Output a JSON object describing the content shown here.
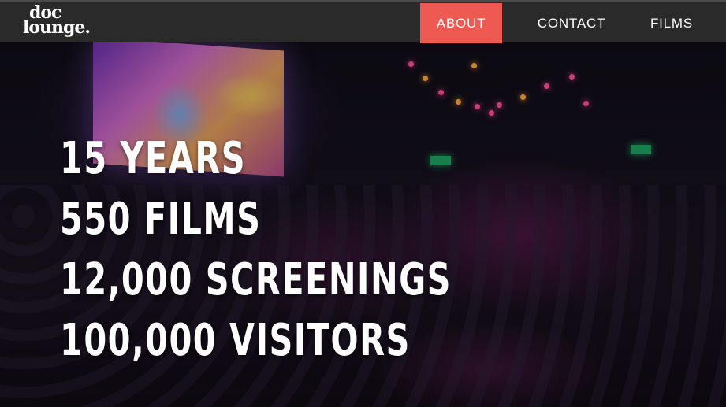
{
  "nav": {
    "logo": {
      "line1": "doc",
      "line2": "lounge."
    },
    "items": [
      {
        "label": "ABOUT",
        "active": true
      },
      {
        "label": "CONTACT",
        "active": false
      },
      {
        "label": "FILMS",
        "active": false
      }
    ]
  },
  "hero": {
    "stats": [
      "15 YEARS",
      "550 FILMS",
      "12,000 SCREENINGS",
      "100,000 VISITORS"
    ]
  },
  "colors": {
    "nav_background": "#2a2a2b",
    "active_accent": "#ee5a52",
    "text": "#ffffff"
  }
}
